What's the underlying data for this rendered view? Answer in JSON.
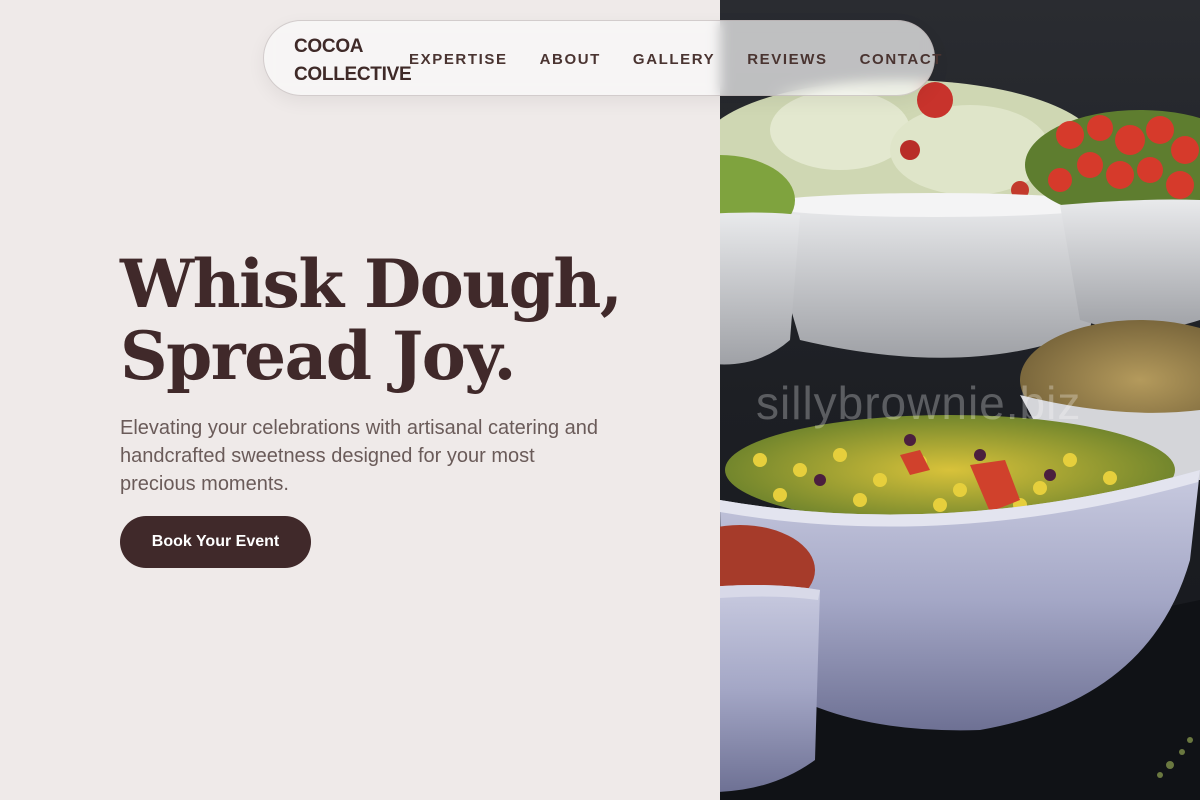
{
  "brand": {
    "name": "COCOA COLLECTIVE"
  },
  "nav": {
    "items": [
      {
        "label": "EXPERTISE"
      },
      {
        "label": "ABOUT"
      },
      {
        "label": "GALLERY"
      },
      {
        "label": "REVIEWS"
      },
      {
        "label": "CONTACT"
      }
    ]
  },
  "hero": {
    "title_line1": "Whisk Dough,",
    "title_line2": "Spread Joy.",
    "subtitle": "Elevating your celebrations with artisanal catering and handcrafted sweetness designed for your most precious moments.",
    "cta_label": "Book Your Event"
  },
  "photo": {
    "watermark": "sillybrownie.biz"
  },
  "colors": {
    "background": "#efeae9",
    "brand_brown": "#40292a",
    "body_text": "#6a5b59",
    "button_text": "#ffffff"
  }
}
